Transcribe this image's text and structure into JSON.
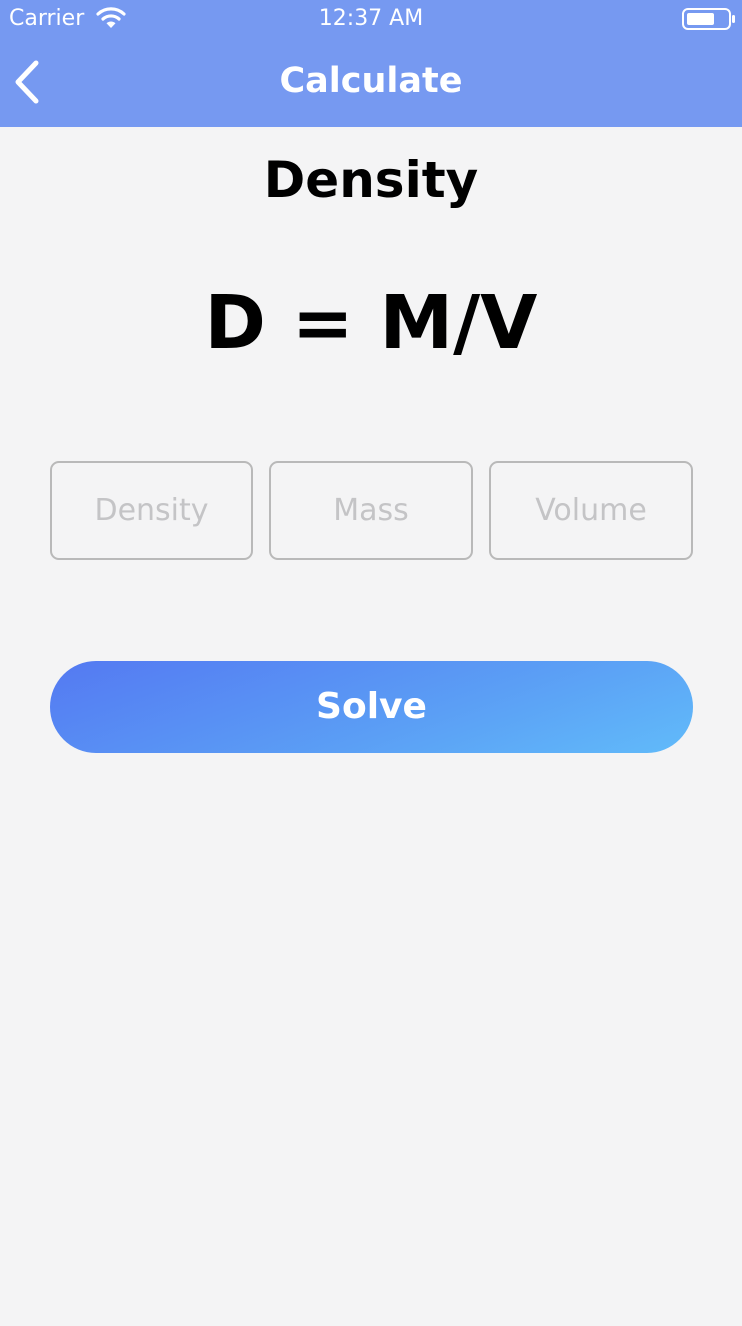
{
  "status_bar": {
    "carrier": "Carrier",
    "time": "12:37 AM",
    "wifi_icon": "wifi-icon",
    "battery_icon": "battery-icon"
  },
  "nav": {
    "back_icon": "chevron-left-icon",
    "title": "Calculate"
  },
  "main": {
    "title": "Density",
    "formula": "D = M/V",
    "fields": {
      "density": {
        "value": "",
        "placeholder": "Density"
      },
      "mass": {
        "value": "",
        "placeholder": "Mass"
      },
      "volume": {
        "value": "",
        "placeholder": "Volume"
      }
    },
    "solve_label": "Solve"
  },
  "colors": {
    "nav_background": "#7699f1",
    "page_background": "#f4f4f5",
    "button_gradient_start": "#5479f2",
    "button_gradient_end": "#61bbfa",
    "field_border": "#b9b9b9",
    "placeholder_text": "#c4c4c6"
  }
}
